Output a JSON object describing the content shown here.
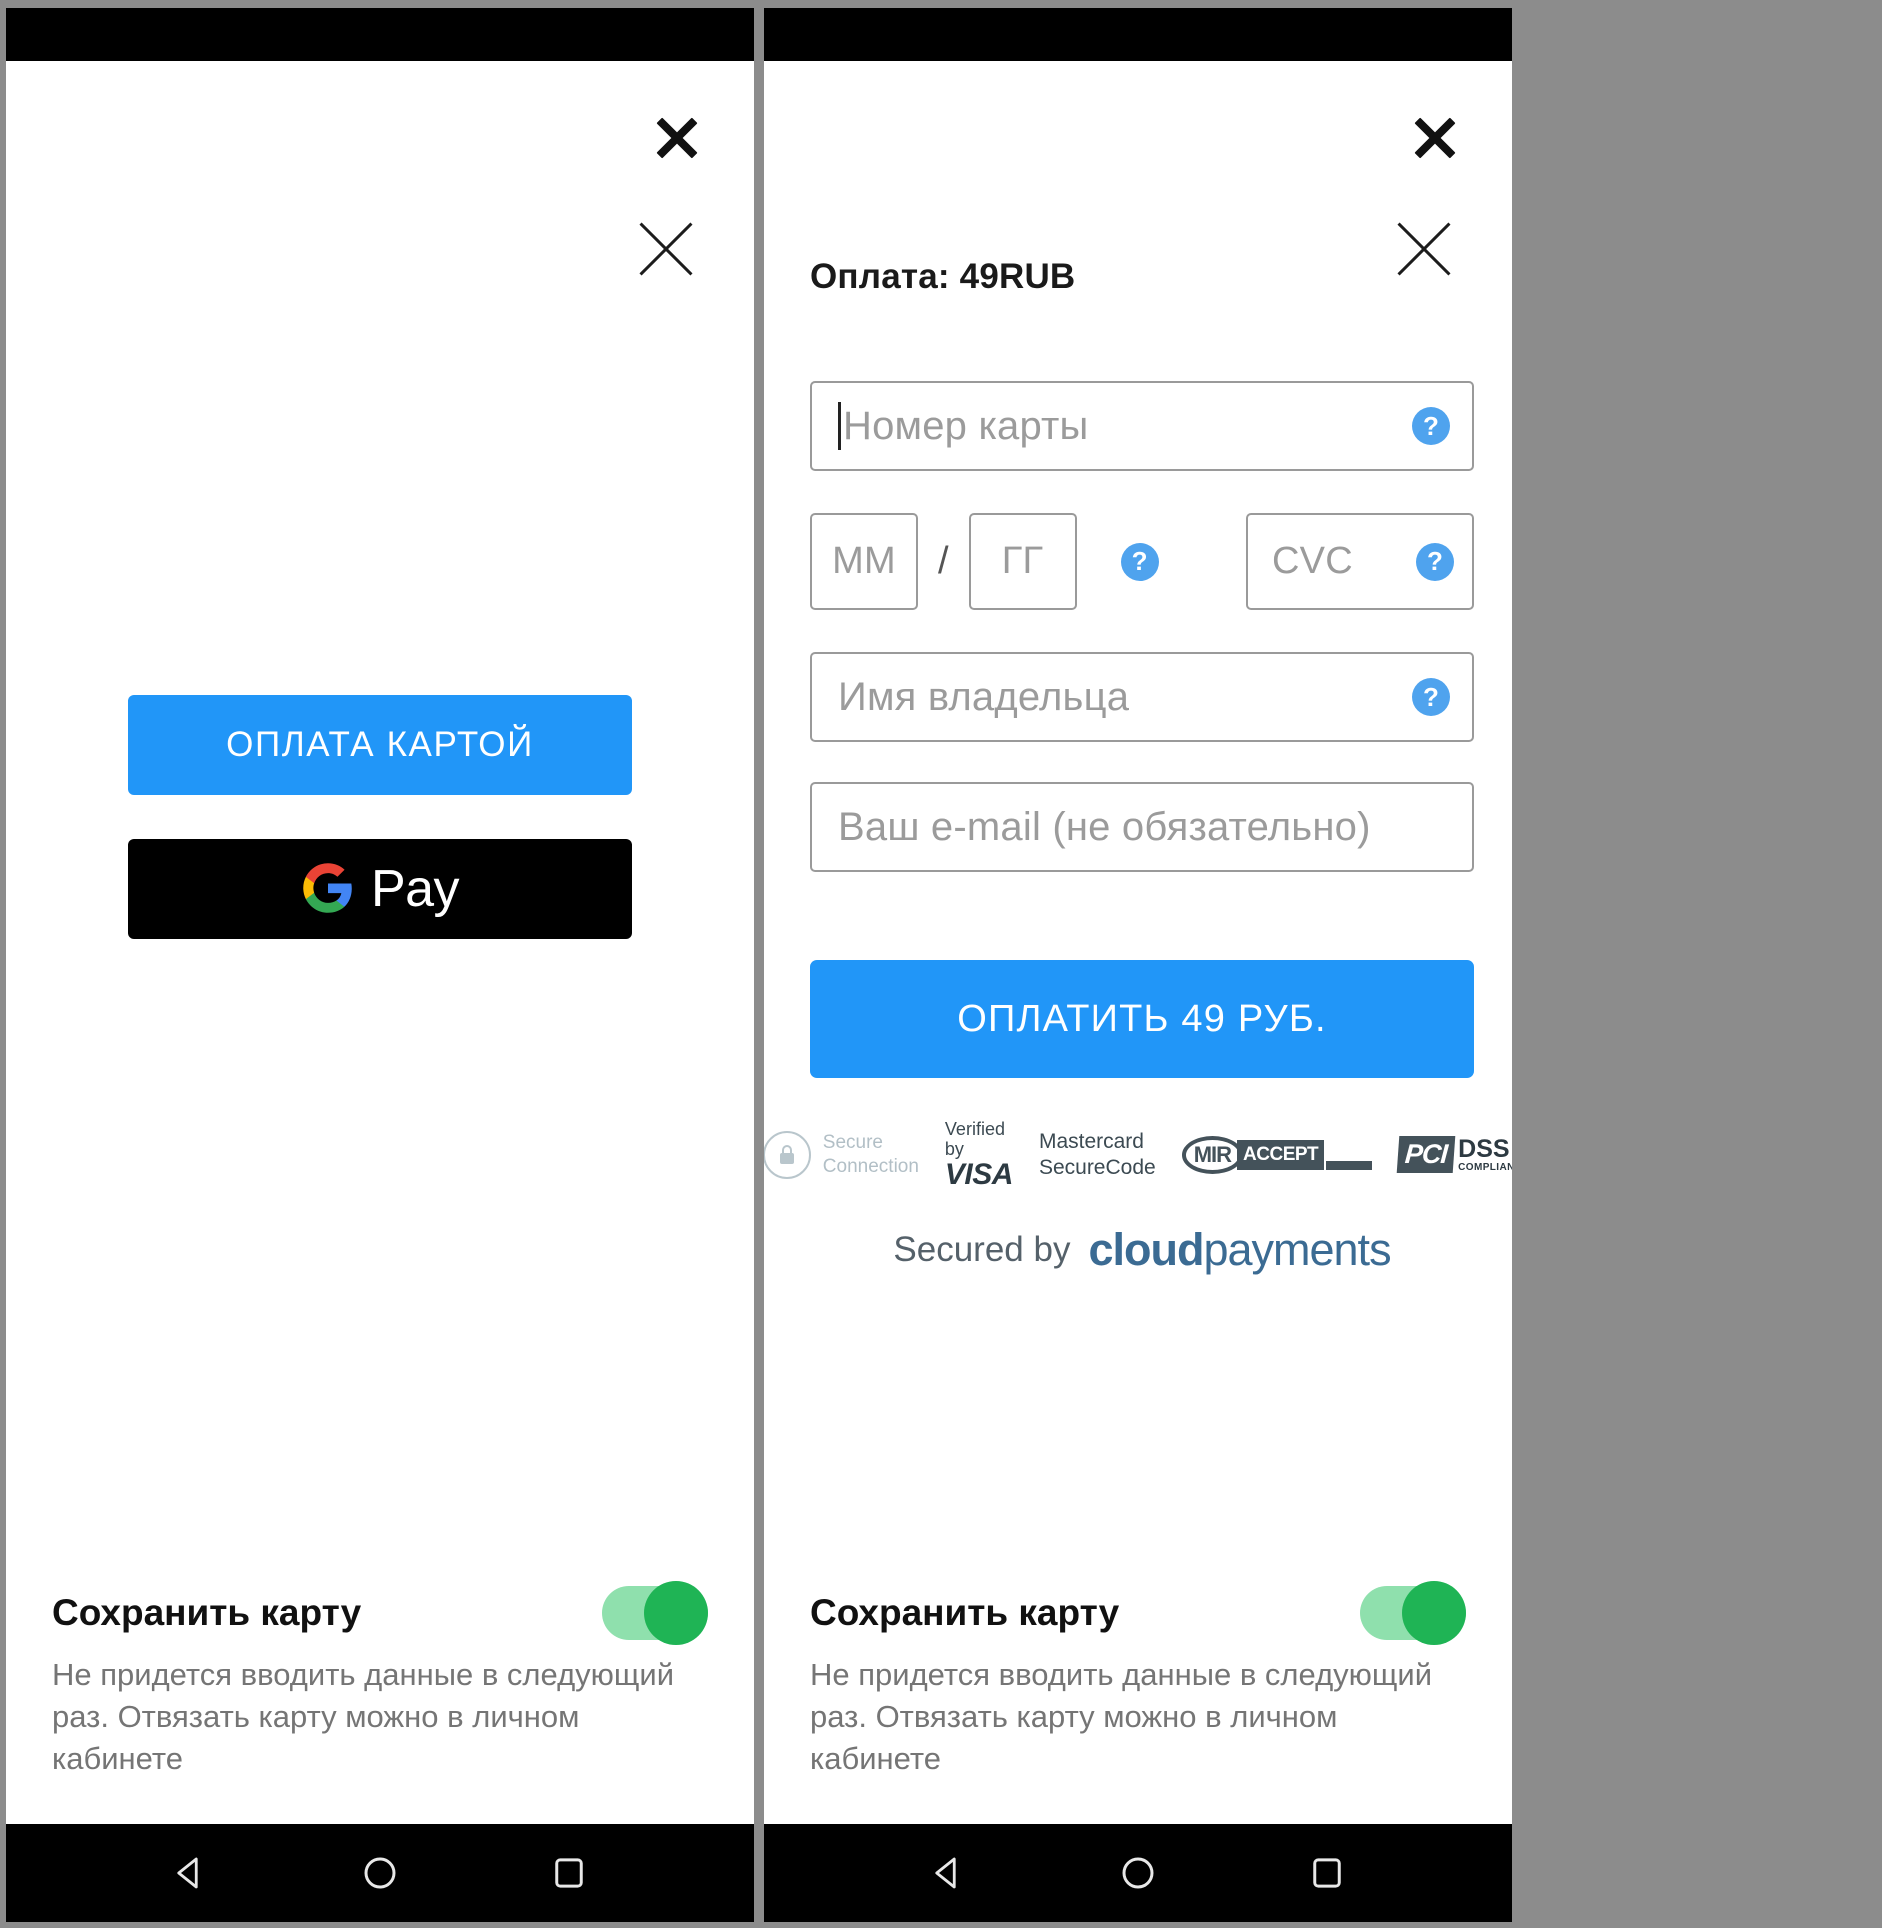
{
  "screens": [
    {
      "id": "payment-method-screen",
      "close_icons": [
        "close-icon-bold",
        "close-icon-thin"
      ],
      "buttons": {
        "pay_by_card": "ОПЛАТА КАРТОЙ",
        "google_pay": "Pay"
      }
    },
    {
      "id": "card-form-screen",
      "close_icons": [
        "close-icon-bold",
        "close-icon-thin"
      ],
      "title": "Оплата: 49RUB",
      "fields": {
        "card_number_placeholder": "Номер карты",
        "card_number_value": "",
        "month_placeholder": "ММ",
        "month_value": "",
        "separator": "/",
        "year_placeholder": "ГГ",
        "year_value": "",
        "cvc_placeholder": "CVC",
        "cvc_value": "",
        "holder_placeholder": "Имя владельца",
        "holder_value": "",
        "email_placeholder": "Ваш e-mail (не обязательно)",
        "email_value": ""
      },
      "help_icon_label": "?",
      "submit_button": "ОПЛАТИТЬ 49 РУБ.",
      "badges": {
        "secure_line1": "Secure",
        "secure_line2": "Connection",
        "visa_top": "Verified by",
        "visa_main": "VISA",
        "mc_line1": "Mastercard",
        "mc_line2": "SecureCode",
        "mir_main": "MIR",
        "mir_accept": "ACCEPT",
        "pci_mark": "PCI",
        "dss_main": "DSS",
        "dss_sub": "COMPLIANT"
      },
      "footer": {
        "secured_by": "Secured by",
        "logo_bold": "cloud",
        "logo_light": "payments"
      }
    }
  ],
  "save_card": {
    "title": "Сохранить карту",
    "description": "Не придется вводить данные в следующий раз. Отвязать карту можно в личном кабинете",
    "toggle_state": "on"
  },
  "navbar": {
    "back": "back-icon",
    "home": "home-icon",
    "recents": "recents-icon"
  },
  "colors": {
    "accent_blue": "#2196f8",
    "toggle_green": "#1fb455",
    "toggle_track": "#8fe0ad",
    "placeholder_gray": "#9b9b9b",
    "border_gray": "#9a9a9a",
    "help_blue": "#4fa3ee",
    "cloudpayments_blue": "#3b6b93"
  }
}
